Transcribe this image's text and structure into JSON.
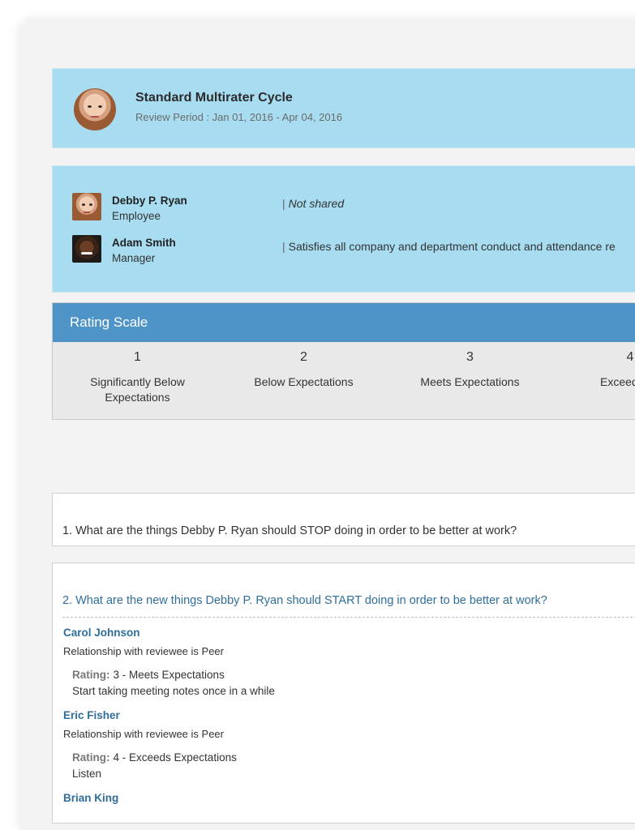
{
  "header": {
    "title": "Standard Multirater Cycle",
    "period": "Review Period : Jan 01, 2016 - Apr 04, 2016"
  },
  "participants": [
    {
      "name": "Debby P. Ryan",
      "role": "Employee",
      "comment": "Not shared"
    },
    {
      "name": "Adam Smith",
      "role": "Manager",
      "comment": "Satisfies all company and department conduct and attendance re"
    }
  ],
  "rating_scale": {
    "title": "Rating Scale",
    "items": [
      {
        "number": "1",
        "label": "Significantly Below Expectations"
      },
      {
        "number": "2",
        "label": "Below Expectations"
      },
      {
        "number": "3",
        "label": "Meets Expectations"
      },
      {
        "number": "4",
        "label": "Exceeds Ex"
      }
    ]
  },
  "questions": [
    {
      "text": "1.  What are the things Debby P.  Ryan should STOP doing in order to be better at work?"
    },
    {
      "text": "2.  What are the new things Debby P.  Ryan should START doing in order to be better at work?",
      "responses": [
        {
          "reviewer": "Carol Johnson",
          "relationship": "Relationship with reviewee is Peer",
          "rating_label": "Rating:",
          "rating": "3 - Meets Expectations",
          "answer": "Start taking meeting notes once in a while"
        },
        {
          "reviewer": "Eric Fisher",
          "relationship": "Relationship with reviewee is Peer",
          "rating_label": "Rating:",
          "rating": "4 - Exceeds Expectations",
          "answer": "Listen"
        },
        {
          "reviewer": "Brian King"
        }
      ]
    }
  ],
  "colors": {
    "panel_bg": "#a8dcf1",
    "rating_header": "#4f94c7",
    "link_blue": "#2f6e9b"
  }
}
